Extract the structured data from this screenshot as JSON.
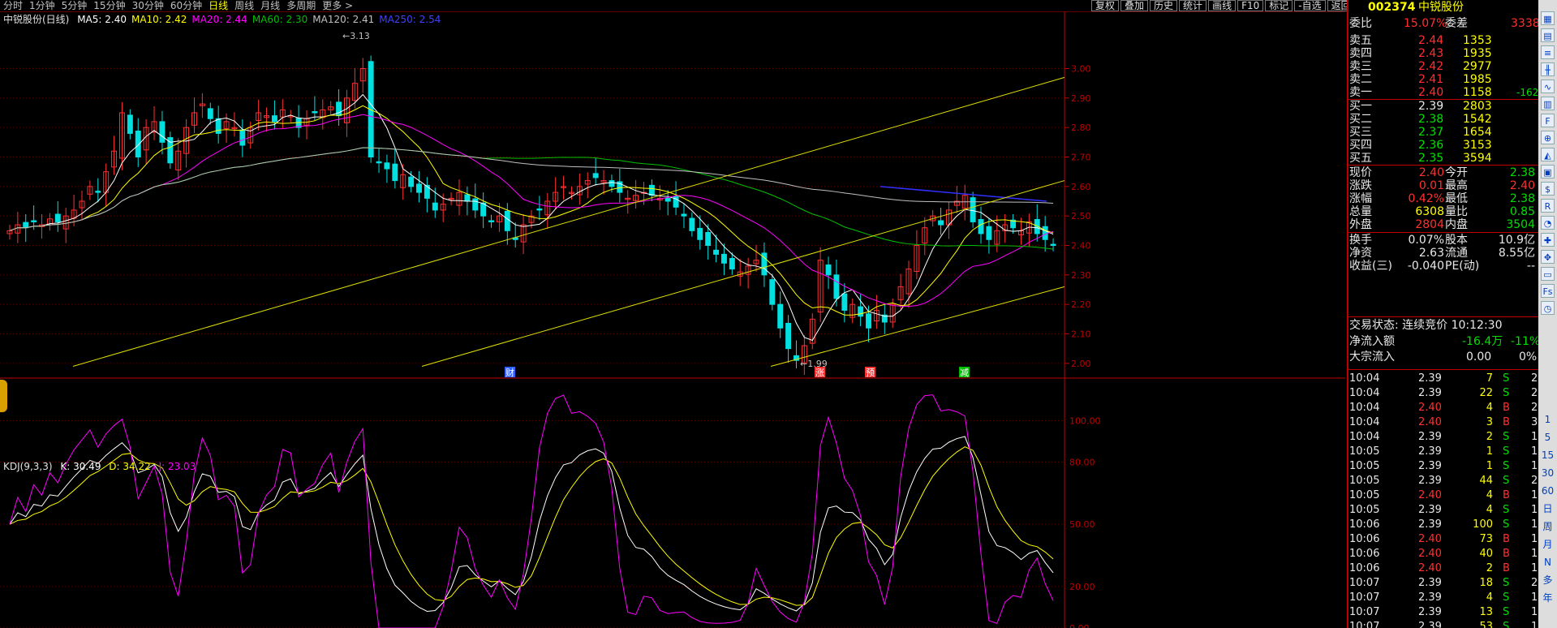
{
  "toolbar": {
    "periods": [
      "分时",
      "1分钟",
      "5分钟",
      "15分钟",
      "30分钟",
      "60分钟",
      "日线",
      "周线",
      "月线",
      "多周期",
      "更多 >"
    ],
    "active_period": "日线",
    "buttons": [
      "复权",
      "叠加",
      "历史",
      "统计",
      "画线",
      "F10",
      "标记",
      "-自选",
      "返回"
    ]
  },
  "main_chart": {
    "title": "中锐股份(日线)",
    "ma": [
      {
        "label": "MA5: 2.40",
        "color": "#ffffff"
      },
      {
        "label": "MA10: 2.42",
        "color": "#ffff00"
      },
      {
        "label": "MA20: 2.44",
        "color": "#ff00ff"
      },
      {
        "label": "MA60: 2.30",
        "color": "#00c000"
      },
      {
        "label": "MA120: 2.41",
        "color": "#c0c0c0"
      },
      {
        "label": "MA250: 2.54",
        "color": "#4040ff"
      }
    ],
    "price_ticks": [
      "3.00",
      "2.90",
      "2.80",
      "2.70",
      "2.60",
      "2.50",
      "2.40",
      "2.30",
      "2.20",
      "2.10",
      "2.00"
    ],
    "high_label": "3.13",
    "low_label": "1.99",
    "event_markers": [
      "财",
      "涨",
      "预",
      "减"
    ]
  },
  "indicator": {
    "title": "KDJ(9,3,3)",
    "k": "K: 30.49",
    "d": "D: 34.22",
    "j": "J: 23.03",
    "ticks": [
      "100.00",
      "80.00",
      "50.00",
      "20.00",
      "0.00"
    ]
  },
  "stock": {
    "code": "002374",
    "name": "中锐股份",
    "weibi_label": "委比",
    "weibi_value": "15.07%",
    "weicha_label": "委差",
    "weicha_value": "3338"
  },
  "sell_orders": [
    {
      "label": "卖五",
      "price": "2.44",
      "volume": "1353",
      "change": ""
    },
    {
      "label": "卖四",
      "price": "2.43",
      "volume": "1935",
      "change": ""
    },
    {
      "label": "卖三",
      "price": "2.42",
      "volume": "2977",
      "change": ""
    },
    {
      "label": "卖二",
      "price": "2.41",
      "volume": "1985",
      "change": ""
    },
    {
      "label": "卖一",
      "price": "2.40",
      "volume": "1158",
      "change": "-162"
    }
  ],
  "buy_orders": [
    {
      "label": "买一",
      "price": "2.39",
      "volume": "2803"
    },
    {
      "label": "买二",
      "price": "2.38",
      "volume": "1542"
    },
    {
      "label": "买三",
      "price": "2.37",
      "volume": "1654"
    },
    {
      "label": "买四",
      "price": "2.36",
      "volume": "3153"
    },
    {
      "label": "买五",
      "price": "2.35",
      "volume": "3594"
    }
  ],
  "stats": [
    {
      "l1": "现价",
      "v1": "2.40",
      "c1": "red",
      "l2": "今开",
      "v2": "2.38",
      "c2": "grn"
    },
    {
      "l1": "涨跌",
      "v1": "0.01",
      "c1": "red",
      "l2": "最高",
      "v2": "2.40",
      "c2": "red"
    },
    {
      "l1": "涨幅",
      "v1": "0.42%",
      "c1": "red",
      "l2": "最低",
      "v2": "2.38",
      "c2": "grn"
    },
    {
      "l1": "总量",
      "v1": "6308",
      "c1": "yel",
      "l2": "量比",
      "v2": "0.85",
      "c2": "grn"
    },
    {
      "l1": "外盘",
      "v1": "2804",
      "c1": "red",
      "l2": "内盘",
      "v2": "3504",
      "c2": "grn"
    }
  ],
  "stats2": [
    {
      "l1": "换手",
      "v1": "0.07%",
      "l2": "股本",
      "v2": "10.9亿"
    },
    {
      "l1": "净资",
      "v1": "2.63",
      "l2": "流通",
      "v2": "8.55亿"
    },
    {
      "l1": "收益(三)",
      "v1": "-0.040",
      "l2": "PE(动)",
      "v2": "--"
    }
  ],
  "trade_status": "交易状态: 连续竞价 10:12:30",
  "net_flow": {
    "label": "净流入额",
    "value": "-16.4万",
    "pct": "-11%"
  },
  "block_flow": {
    "label": "大宗流入",
    "value": "0.00",
    "pct": "0%"
  },
  "ticks": [
    {
      "t": "10:04",
      "p": "2.39",
      "v": "7",
      "d": "S",
      "n": "2",
      "pc": "wht"
    },
    {
      "t": "10:04",
      "p": "2.39",
      "v": "22",
      "d": "S",
      "n": "2",
      "pc": "wht"
    },
    {
      "t": "10:04",
      "p": "2.40",
      "v": "4",
      "d": "B",
      "n": "2",
      "pc": "red"
    },
    {
      "t": "10:04",
      "p": "2.40",
      "v": "3",
      "d": "B",
      "n": "3",
      "pc": "red"
    },
    {
      "t": "10:04",
      "p": "2.39",
      "v": "2",
      "d": "S",
      "n": "1",
      "pc": "wht"
    },
    {
      "t": "10:05",
      "p": "2.39",
      "v": "1",
      "d": "S",
      "n": "1",
      "pc": "wht"
    },
    {
      "t": "10:05",
      "p": "2.39",
      "v": "1",
      "d": "S",
      "n": "1",
      "pc": "wht"
    },
    {
      "t": "10:05",
      "p": "2.39",
      "v": "44",
      "d": "S",
      "n": "2",
      "pc": "wht"
    },
    {
      "t": "10:05",
      "p": "2.40",
      "v": "4",
      "d": "B",
      "n": "1",
      "pc": "red"
    },
    {
      "t": "10:05",
      "p": "2.39",
      "v": "4",
      "d": "S",
      "n": "1",
      "pc": "wht"
    },
    {
      "t": "10:06",
      "p": "2.39",
      "v": "100",
      "d": "S",
      "n": "1",
      "pc": "wht"
    },
    {
      "t": "10:06",
      "p": "2.40",
      "v": "73",
      "d": "B",
      "n": "1",
      "pc": "red"
    },
    {
      "t": "10:06",
      "p": "2.40",
      "v": "40",
      "d": "B",
      "n": "1",
      "pc": "red"
    },
    {
      "t": "10:06",
      "p": "2.40",
      "v": "2",
      "d": "B",
      "n": "1",
      "pc": "red"
    },
    {
      "t": "10:07",
      "p": "2.39",
      "v": "18",
      "d": "S",
      "n": "2",
      "pc": "wht"
    },
    {
      "t": "10:07",
      "p": "2.39",
      "v": "4",
      "d": "S",
      "n": "1",
      "pc": "wht"
    },
    {
      "t": "10:07",
      "p": "2.39",
      "v": "13",
      "d": "S",
      "n": "1",
      "pc": "wht"
    },
    {
      "t": "10:07",
      "p": "2.39",
      "v": "53",
      "d": "S",
      "n": "1",
      "pc": "wht"
    }
  ],
  "sidebar_labels": [
    "1",
    "5",
    "15",
    "30",
    "60",
    "日",
    "周",
    "月",
    "N",
    "多",
    "年"
  ],
  "sidebar_icons": [
    "chart-icon",
    "grid-icon",
    "list-icon",
    "kline-icon",
    "line-icon",
    "bars-icon",
    "f10-icon",
    "zoom-icon",
    "area-icon",
    "table-icon",
    "dollar-icon",
    "rsi-icon",
    "pie-icon",
    "cross-icon",
    "move-icon",
    "level-icon",
    "fs-icon",
    "clock-icon"
  ],
  "chart_data": {
    "type": "candlestick",
    "price_ylim": [
      1.95,
      3.15
    ],
    "kdj_ylim": [
      0,
      115
    ],
    "closes": [
      2.45,
      2.47,
      2.46,
      2.48,
      2.47,
      2.49,
      2.48,
      2.5,
      2.52,
      2.55,
      2.6,
      2.58,
      2.65,
      2.72,
      2.85,
      2.78,
      2.7,
      2.8,
      2.82,
      2.75,
      2.68,
      2.72,
      2.8,
      2.85,
      2.88,
      2.83,
      2.78,
      2.82,
      2.8,
      2.74,
      2.8,
      2.85,
      2.84,
      2.82,
      2.86,
      2.84,
      2.8,
      2.83,
      2.85,
      2.86,
      2.87,
      2.84,
      2.9,
      2.95,
      3.0,
      2.7,
      2.68,
      2.66,
      2.62,
      2.64,
      2.6,
      2.58,
      2.56,
      2.52,
      2.54,
      2.56,
      2.58,
      2.55,
      2.52,
      2.5,
      2.48,
      2.5,
      2.45,
      2.42,
      2.47,
      2.5,
      2.52,
      2.55,
      2.58,
      2.6,
      2.58,
      2.6,
      2.62,
      2.63,
      2.62,
      2.6,
      2.58,
      2.56,
      2.57,
      2.58,
      2.57,
      2.56,
      2.55,
      2.53,
      2.5,
      2.45,
      2.42,
      2.4,
      2.37,
      2.34,
      2.32,
      2.31,
      2.33,
      2.35,
      2.3,
      2.2,
      2.12,
      2.05,
      2.01,
      2.06,
      2.15,
      2.35,
      2.3,
      2.22,
      2.18,
      2.2,
      2.16,
      2.12,
      2.18,
      2.14,
      2.2,
      2.26,
      2.32,
      2.4,
      2.46,
      2.5,
      2.47,
      2.52,
      2.55,
      2.57,
      2.48,
      2.44,
      2.42,
      2.45,
      2.47,
      2.46,
      2.45,
      2.48,
      2.44,
      2.42,
      2.4
    ]
  }
}
